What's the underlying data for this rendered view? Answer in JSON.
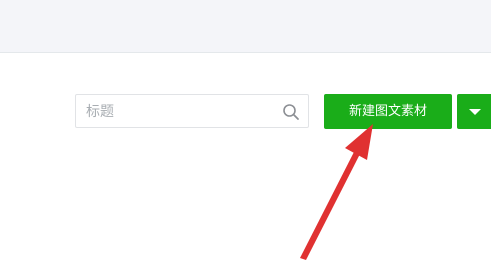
{
  "search": {
    "placeholder": "标题",
    "icon": "search-icon"
  },
  "actions": {
    "new_article_label": "新建图文素材",
    "dropdown_icon": "caret-down-icon"
  },
  "colors": {
    "primary_green": "#1aad19",
    "annotation_red": "#e03131",
    "top_band": "#f4f5f9"
  }
}
